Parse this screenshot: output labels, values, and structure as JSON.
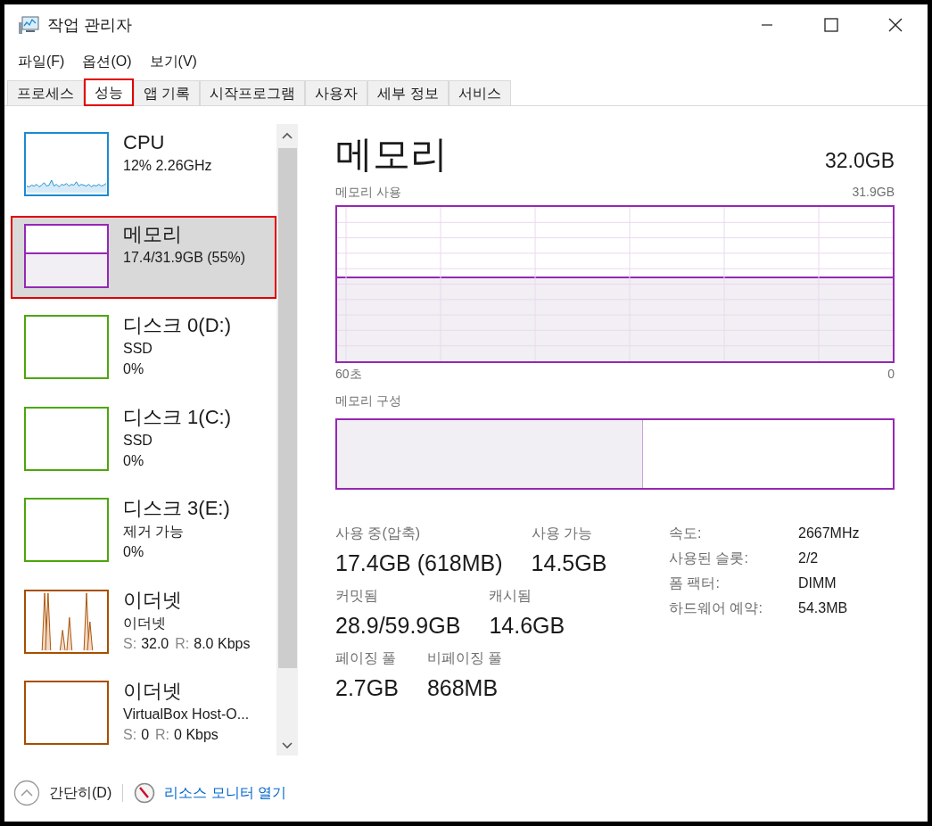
{
  "window": {
    "title": "작업 관리자"
  },
  "menu": [
    "파일(F)",
    "옵션(O)",
    "보기(V)"
  ],
  "tabs": [
    {
      "label": "프로세스",
      "selected": false
    },
    {
      "label": "성능",
      "selected": true
    },
    {
      "label": "앱 기록",
      "selected": false
    },
    {
      "label": "시작프로그램",
      "selected": false
    },
    {
      "label": "사용자",
      "selected": false
    },
    {
      "label": "세부 정보",
      "selected": false
    },
    {
      "label": "서비스",
      "selected": false
    }
  ],
  "sidebar": {
    "items": [
      {
        "kind": "cpu",
        "color": "#1a8bd0",
        "title": "CPU",
        "lines": [
          "12% 2.26GHz"
        ],
        "selected": false
      },
      {
        "kind": "memory",
        "color": "#9528b4",
        "title": "메모리",
        "lines": [
          "17.4/31.9GB (55%)"
        ],
        "selected": true
      },
      {
        "kind": "disk",
        "color": "#4da60c",
        "title": "디스크 0(D:)",
        "lines": [
          "SSD",
          "0%"
        ],
        "selected": false
      },
      {
        "kind": "disk",
        "color": "#4da60c",
        "title": "디스크 1(C:)",
        "lines": [
          "SSD",
          "0%"
        ],
        "selected": false
      },
      {
        "kind": "disk",
        "color": "#4da60c",
        "title": "디스크 3(E:)",
        "lines": [
          "제거 가능",
          "0%"
        ],
        "selected": false
      },
      {
        "kind": "network",
        "color": "#a74f01",
        "title": "이더넷",
        "lines": [
          "이더넷"
        ],
        "rates": [
          {
            "label": "S:",
            "value": "32.0"
          },
          {
            "label": "R:",
            "value": "8.0 Kbps"
          }
        ],
        "active": true,
        "selected": false
      },
      {
        "kind": "network",
        "color": "#a74f01",
        "title": "이더넷",
        "lines": [
          "VirtualBox Host-O..."
        ],
        "rates": [
          {
            "label": "S:",
            "value": "0"
          },
          {
            "label": "R:",
            "value": "0 Kbps"
          }
        ],
        "active": false,
        "selected": false
      }
    ]
  },
  "detail": {
    "title": "메모리",
    "total": "32.0GB",
    "usage_label": "메모리 사용",
    "usage_max": "31.9GB",
    "time_start": "60초",
    "time_end": "0",
    "composition_label": "메모리 구성",
    "composition": {
      "level": 0.55
    },
    "stats": [
      [
        {
          "label": "사용 중(압축)",
          "value": "17.4GB (618MB)"
        },
        {
          "label": "사용 가능",
          "value": "14.5GB"
        }
      ],
      [
        {
          "label": "커밋됨",
          "value": "28.9/59.9GB"
        },
        {
          "label": "캐시됨",
          "value": "14.6GB"
        }
      ],
      [
        {
          "label": "페이징 풀",
          "value": "2.7GB"
        },
        {
          "label": "비페이징 풀",
          "value": "868MB"
        }
      ]
    ],
    "properties": [
      {
        "label": "속도:",
        "value": "2667MHz"
      },
      {
        "label": "사용된 슬롯:",
        "value": "2/2"
      },
      {
        "label": "폼 팩터:",
        "value": "DIMM"
      },
      {
        "label": "하드웨어 예약:",
        "value": "54.3MB"
      }
    ]
  },
  "footer": {
    "collapse": "간단히(D)",
    "monitor_link": "리소스 모니터 열기"
  }
}
